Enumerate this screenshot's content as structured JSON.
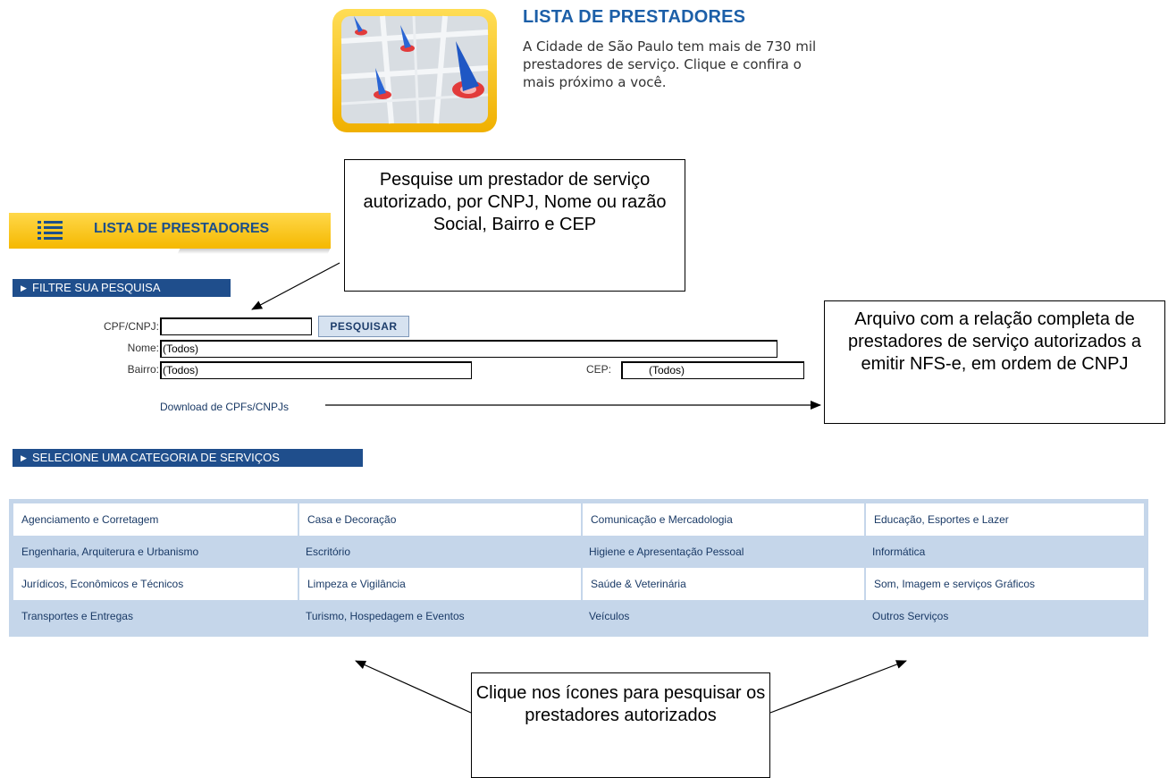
{
  "hero": {
    "title": "LISTA DE PRESTADORES",
    "description": "A Cidade de São Paulo tem mais de 730 mil prestadores de serviço. Clique e confira o mais próximo a você."
  },
  "list_header": {
    "title": "LISTA DE PRESTADORES"
  },
  "filter_section": {
    "label": "FILTRE SUA PESQUISA"
  },
  "form": {
    "cpf_label": "CPF/CNPJ:",
    "cpf_value": "",
    "search_button": "PESQUISAR",
    "nome_label": "Nome:",
    "nome_value": "(Todos)",
    "bairro_label": "Bairro:",
    "bairro_value": "(Todos)",
    "cep_label": "CEP:",
    "cep_value": "(Todos)",
    "download_link": "Download de CPFs/CNPJs"
  },
  "category_section": {
    "label": "SELECIONE UMA CATEGORIA DE SERVIÇOS"
  },
  "categories": [
    [
      "Agenciamento e Corretagem",
      "Casa e Decoração",
      "Comunicação e Mercadologia",
      "Educação, Esportes e Lazer"
    ],
    [
      "Engenharia, Arquiterura e Urbanismo",
      "Escritório",
      "Higiene e Apresentação Pessoal",
      "Informática"
    ],
    [
      "Jurídicos, Econômicos e Técnicos",
      "Limpeza e Vigilância",
      "Saúde & Veterinária",
      "Som, Imagem e serviços Gráficos"
    ],
    [
      "Transportes e Entregas",
      "Turismo, Hospedagem e Eventos",
      "Veículos",
      "Outros Serviços"
    ]
  ],
  "callouts": {
    "search_note": "Pesquise um prestador de serviço autorizado, por CNPJ, Nome ou razão Social, Bairro e CEP",
    "download_note": "Arquivo com a relação completa de prestadores de serviço autorizados a emitir NFS-e, em ordem de CNPJ",
    "icons_note": "Clique nos ícones para pesquisar os prestadores autorizados"
  },
  "colors": {
    "brand_blue": "#1f4e8c",
    "accent_yellow": "#f5b800",
    "table_blue": "#c5d6ea"
  }
}
